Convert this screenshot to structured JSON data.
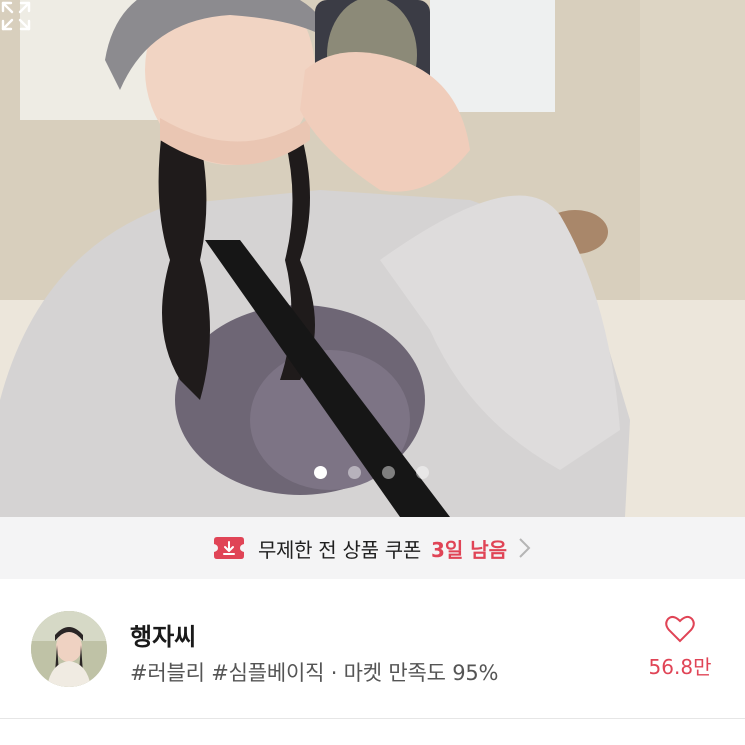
{
  "gallery": {
    "image_alt": "",
    "total_images": 4,
    "active_index": 0,
    "expand_icon": "expand-icon"
  },
  "coupon": {
    "icon": "coupon-download-icon",
    "text": "무제한 전 상품 쿠폰",
    "days_left": "3일 남음",
    "chevron_icon": "chevron-right-icon",
    "accent_color": "#e04456"
  },
  "shop": {
    "name": "행자씨",
    "tags": "#러블리 #심플베이직 · 마켓 만족도 95%",
    "like_icon": "heart-outline-icon",
    "like_count": "56.8만"
  }
}
